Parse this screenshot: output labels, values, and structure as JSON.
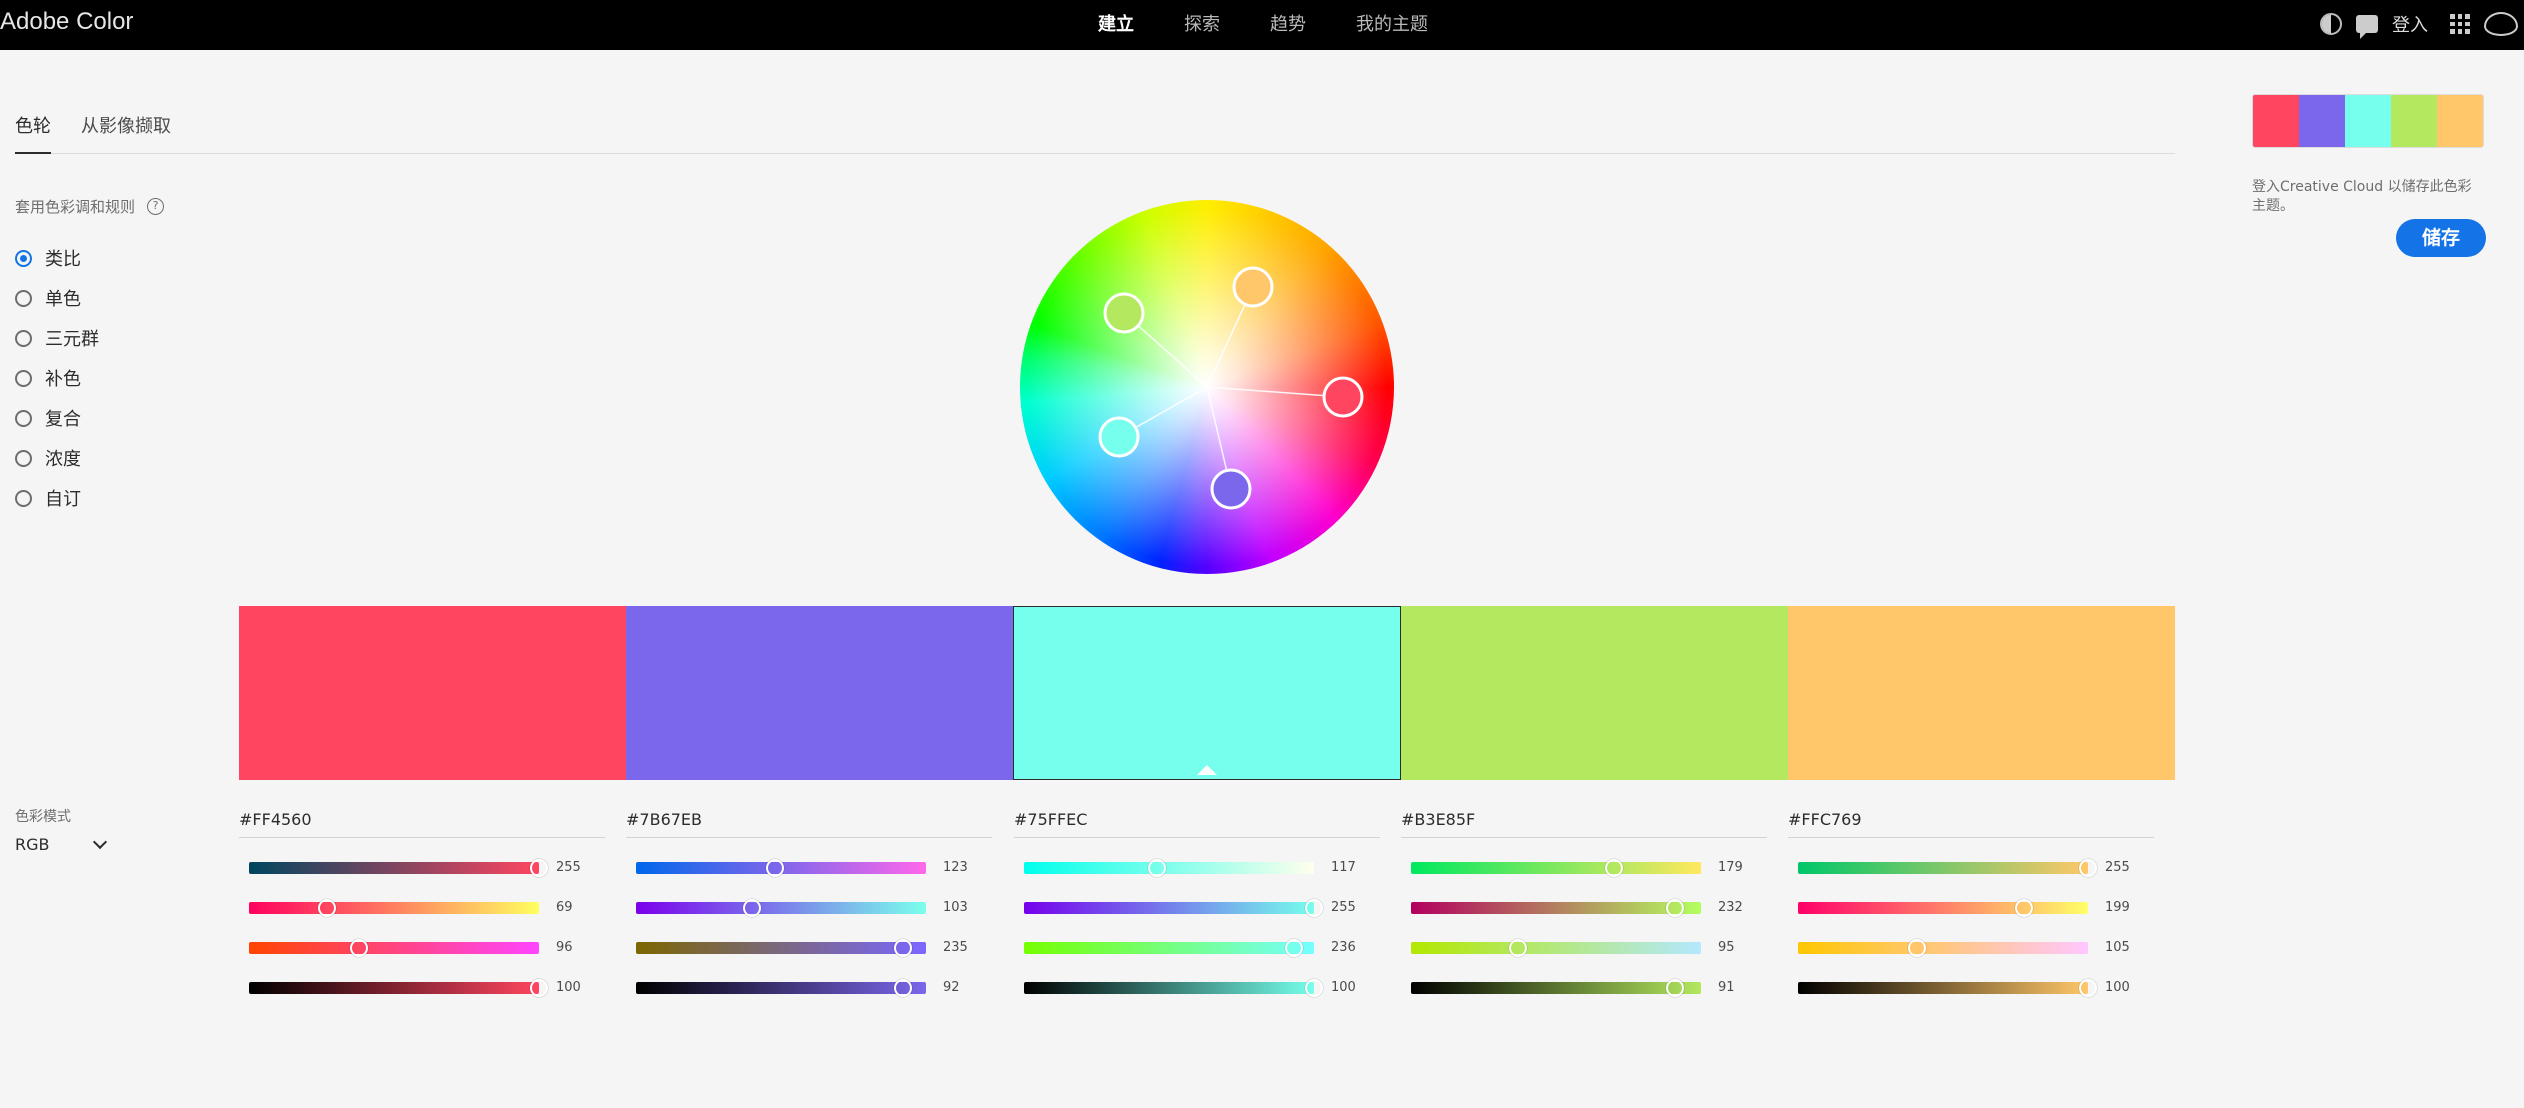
{
  "app": {
    "brand": "Adobe Color",
    "nav": [
      "建立",
      "探索",
      "趋势",
      "我的主题"
    ],
    "login": "登入"
  },
  "tabs": [
    "色轮",
    "从影像撷取"
  ],
  "rules": {
    "heading": "套用色彩调和规则",
    "help": "?",
    "options": [
      "类比",
      "单色",
      "三元群",
      "补色",
      "复合",
      "浓度",
      "自订"
    ],
    "selected": "类比"
  },
  "color_mode": {
    "label": "色彩模式",
    "value": "RGB"
  },
  "swatches": [
    {
      "hex": "#FF4560",
      "color": "#FF4560"
    },
    {
      "hex": "#7B67EB",
      "color": "#7B67EB"
    },
    {
      "hex": "#75FFEC",
      "color": "#75FFEC"
    },
    {
      "hex": "#B3E85F",
      "color": "#B3E85F"
    },
    {
      "hex": "#FFC769",
      "color": "#FFC769"
    }
  ],
  "selected_swatch": 2,
  "sliders": [
    [
      {
        "value": "255",
        "level": 1.0
      },
      {
        "value": "69",
        "level": 0.27
      },
      {
        "value": "96",
        "level": 0.38
      },
      {
        "value": "100",
        "level": 1.0
      }
    ],
    [
      {
        "value": "123",
        "level": 0.48
      },
      {
        "value": "103",
        "level": 0.4
      },
      {
        "value": "235",
        "level": 0.92
      },
      {
        "value": "92",
        "level": 0.92
      }
    ],
    [
      {
        "value": "117",
        "level": 0.46
      },
      {
        "value": "255",
        "level": 1.0
      },
      {
        "value": "236",
        "level": 0.93
      },
      {
        "value": "100",
        "level": 1.0
      }
    ],
    [
      {
        "value": "179",
        "level": 0.7
      },
      {
        "value": "232",
        "level": 0.91
      },
      {
        "value": "95",
        "level": 0.37
      },
      {
        "value": "91",
        "level": 0.91
      }
    ],
    [
      {
        "value": "255",
        "level": 1.0
      },
      {
        "value": "199",
        "level": 0.78
      },
      {
        "value": "105",
        "level": 0.41
      },
      {
        "value": "100",
        "level": 1.0
      }
    ]
  ],
  "save_panel": {
    "note": "登入Creative Cloud 以储存此色彩主题。",
    "button": "储存"
  }
}
